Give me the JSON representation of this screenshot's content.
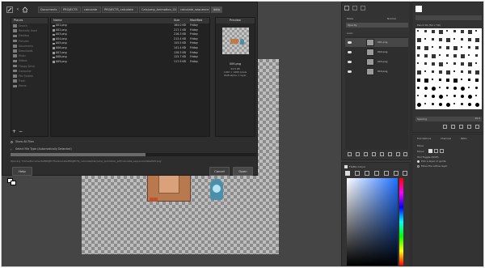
{
  "dialog": {
    "path_buttons": [
      "Documents",
      "PROJECTS",
      "calculate",
      "PROJECTS_calculate",
      "Calcjump_Animation_GIF",
      "calculate_sequence",
      "data"
    ],
    "places_header": "Places",
    "places": [
      "Search",
      "Recently Used",
      "Desktop",
      "Pictures",
      "Documents",
      "Downloads",
      "Music",
      "Videos",
      "Floppy Drive",
      "Computer",
      "File System",
      "Trash",
      "Home"
    ],
    "columns": {
      "name": "Name",
      "size": "Size",
      "modified": "Modified"
    },
    "files": [
      {
        "name": "001.png",
        "size": "164.0 KB",
        "modified": "Friday"
      },
      {
        "name": "002.png",
        "size": "217.1 KB",
        "modified": "Friday"
      },
      {
        "name": "003.png",
        "size": "216.3 KB",
        "modified": "Friday"
      },
      {
        "name": "004.png",
        "size": "213.4 KB",
        "modified": "Friday"
      },
      {
        "name": "005.png",
        "size": "155.5 KB",
        "modified": "Friday"
      },
      {
        "name": "006.png",
        "size": "141.4 KB",
        "modified": "Friday"
      },
      {
        "name": "007.png",
        "size": "128.3 KB",
        "modified": "Friday"
      },
      {
        "name": "008.png",
        "size": "125.7 KB",
        "modified": "Friday"
      },
      {
        "name": "009.png",
        "size": "117.9 KB",
        "modified": "Friday"
      }
    ],
    "preview_header": "Preview",
    "preview_caption": "009.png",
    "preview_info": [
      "54.5 KB",
      "1920 × 1080 pixels",
      "RGB-alpha, 1 layer"
    ],
    "add_symbol": "+",
    "remove_symbol": "−",
    "show_all_files": "Show All Files",
    "file_type": "Select File Type (Automatically Detected)",
    "progress": 0.55,
    "status_path": "Opening '/home/Documents/PROJECTS/calculate/PROJECTS_calculate/Calcjump_Animation_GIF/calculate_sequence/data/009.png'",
    "help_label": "Help",
    "cancel_label": "Cancel",
    "open_label": "Open"
  },
  "layers": {
    "mode_label": "Mode",
    "mode_value": "Normal",
    "opacity_label": "Opacity",
    "lock_label": "Lock:",
    "items": [
      "001.png",
      "002.png",
      "003.png",
      "004.png"
    ]
  },
  "brushes": {
    "filter_placeholder": "Filter",
    "current": "Pencil 02 (50 × 50)",
    "spacing_label": "Spacing",
    "spacing_value": "10.0"
  },
  "tool_options": {
    "tabs": [
      "Tool Options",
      "Channels",
      "Paths"
    ],
    "title": "Move",
    "move_label": "Move:",
    "toggle_label": "Tool Toggle (Shift)",
    "option1": "Pick a layer or guide",
    "option2": "Move the active layer"
  },
  "colors": {
    "title": "FG/BG Colour"
  }
}
